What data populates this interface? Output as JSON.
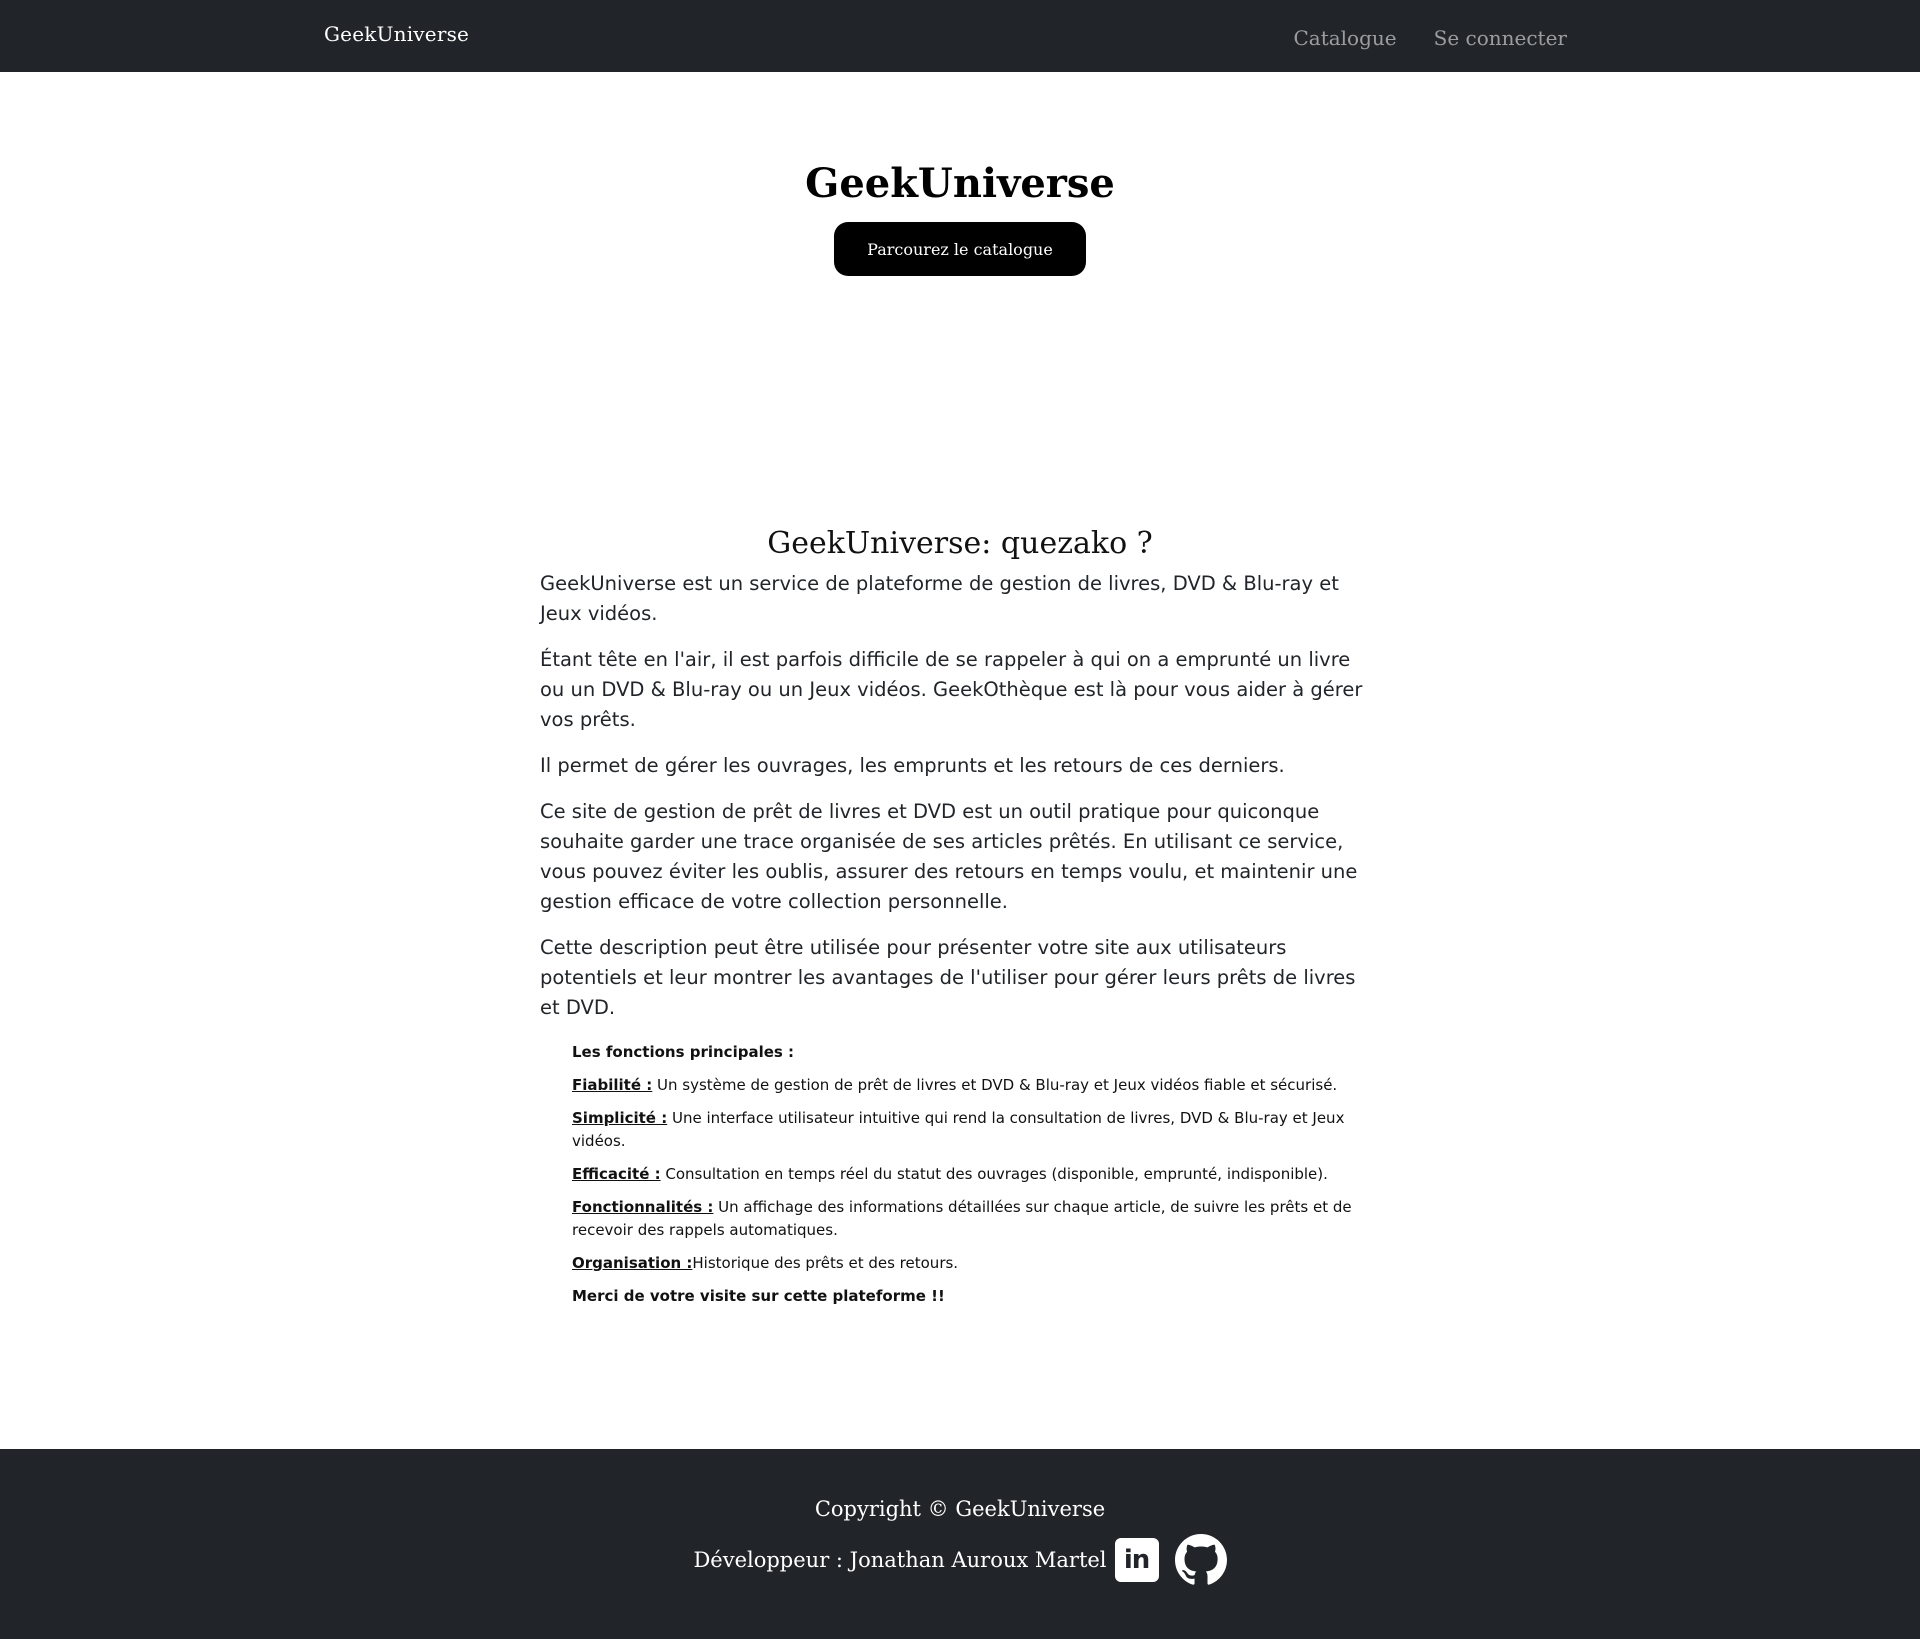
{
  "navbar": {
    "brand": "GeekUniverse",
    "links": [
      "Catalogue",
      "Se connecter"
    ]
  },
  "hero": {
    "title": "GeekUniverse",
    "button_label": "Parcourez le catalogue"
  },
  "about": {
    "heading": "GeekUniverse: quezako ?",
    "paragraphs": [
      "GeekUniverse est un service de plateforme de gestion de livres, DVD & Blu-ray et Jeux vidéos.",
      "Étant tête en l'air, il est parfois difficile de se rappeler à qui on a emprunté un livre ou un DVD & Blu-ray ou un Jeux vidéos. GeekOthèque est là pour vous aider à gérer vos prêts.",
      "Il permet de gérer les ouvrages, les emprunts et les retours de ces derniers.",
      "Ce site de gestion de prêt de livres et DVD est un outil pratique pour quiconque souhaite garder une trace organisée de ses articles prêtés. En utilisant ce service, vous pouvez éviter les oublis, assurer des retours en temps voulu, et maintenir une gestion efficace de votre collection personnelle.",
      "Cette description peut être utilisée pour présenter votre site aux utilisateurs potentiels et leur montrer les avantages de l'utiliser pour gérer leurs prêts de livres et DVD."
    ],
    "features_title": "Les fonctions principales :",
    "features": [
      {
        "label": "Fiabilité :",
        "text": " Un système de gestion de prêt de livres et DVD & Blu-ray et Jeux vidéos fiable et sécurisé."
      },
      {
        "label": "Simplicité :",
        "text": " Une interface utilisateur intuitive qui rend la consultation de livres, DVD & Blu-ray et Jeux vidéos."
      },
      {
        "label": "Efficacité :",
        "text": " Consultation en temps réel du statut des ouvrages (disponible, emprunté, indisponible)."
      },
      {
        "label": "Fonctionnalités :",
        "text": " Un affichage des informations détaillées sur chaque article, de suivre les prêts et de recevoir des rappels automatiques."
      },
      {
        "label": "Organisation :",
        "text": "Historique des prêts et des retours."
      }
    ],
    "closing": "Merci de votre visite sur cette plateforme !!"
  },
  "footer": {
    "copyright": "Copyright © GeekUniverse",
    "developer": "Développeur : Jonathan Auroux Martel",
    "social_icons": [
      "linkedin-icon",
      "github-icon"
    ],
    "linkedin_glyph": "in"
  }
}
